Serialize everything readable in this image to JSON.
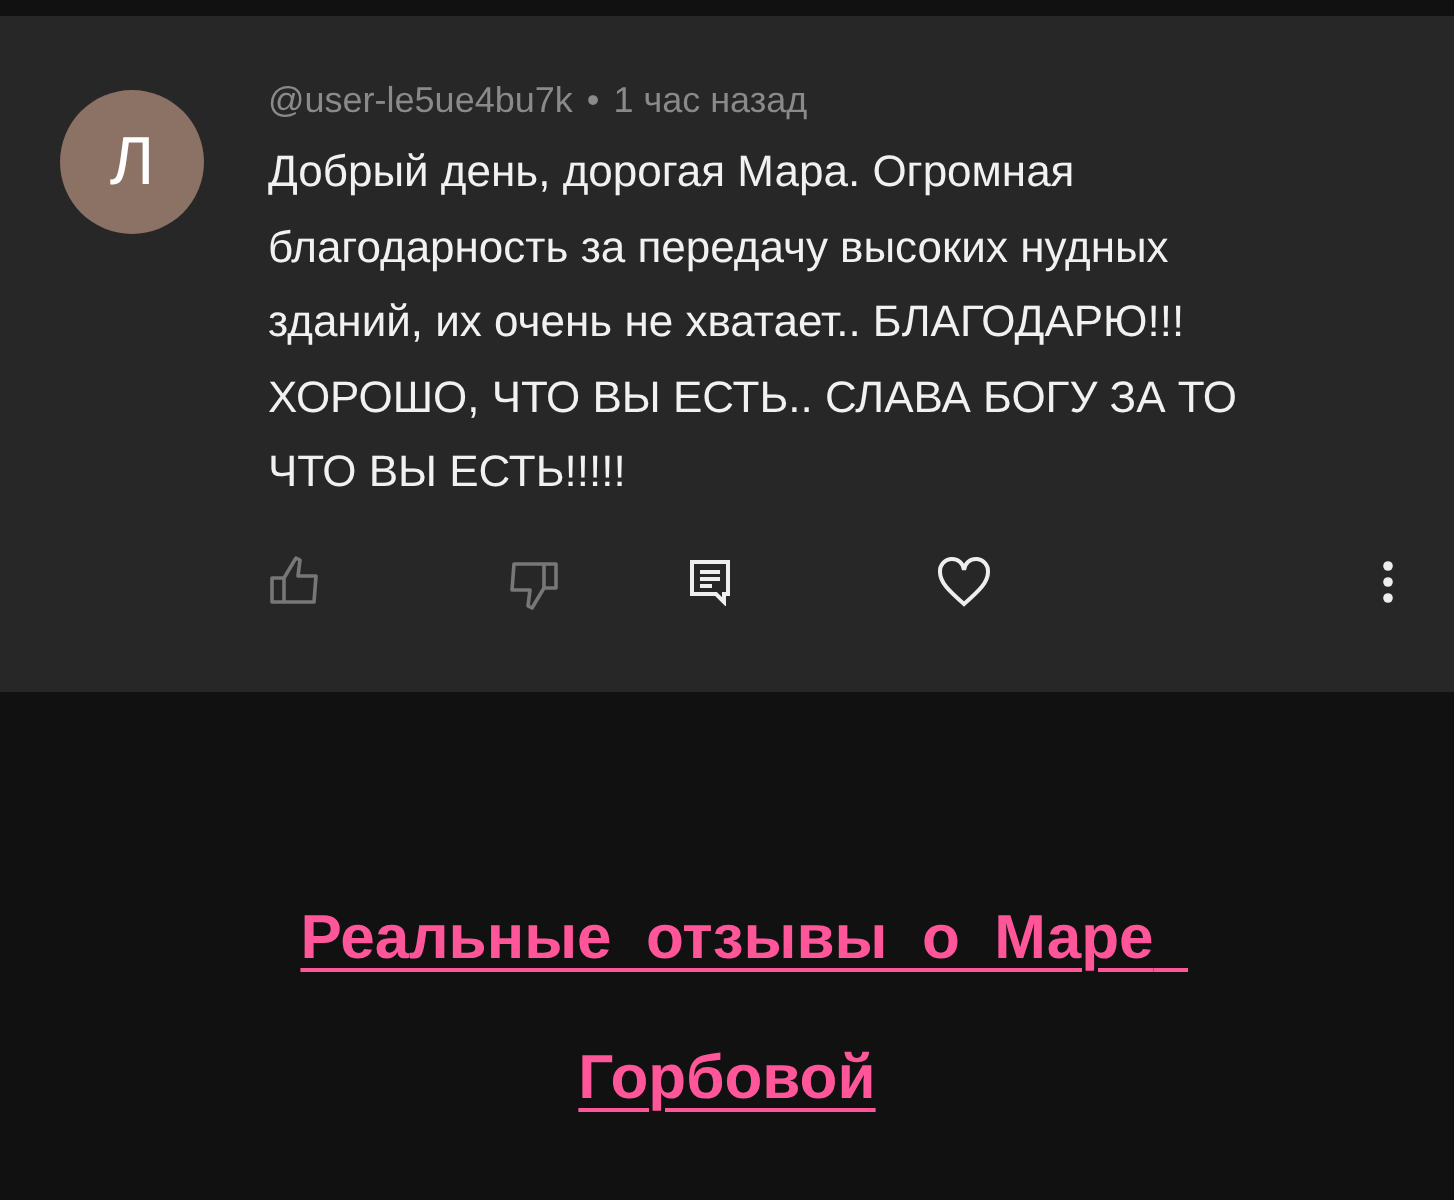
{
  "comment": {
    "avatar_letter": "Л",
    "author": "@user-le5ue4bu7k",
    "separator": "•",
    "time": "1 час назад",
    "text": "Добрый день, дорогая Мара. Огромная благодарность за передачу высоких нудных зданий, их очень не хватает.. БЛАГОДАРЮ!!! ХОРОШО, ЧТО ВЫ ЕСТЬ.. СЛАВА БОГУ ЗА ТО ЧТО ВЫ ЕСТЬ!!!!!"
  },
  "link": "Реальные  отзывы  о  Маре  Горбовой"
}
